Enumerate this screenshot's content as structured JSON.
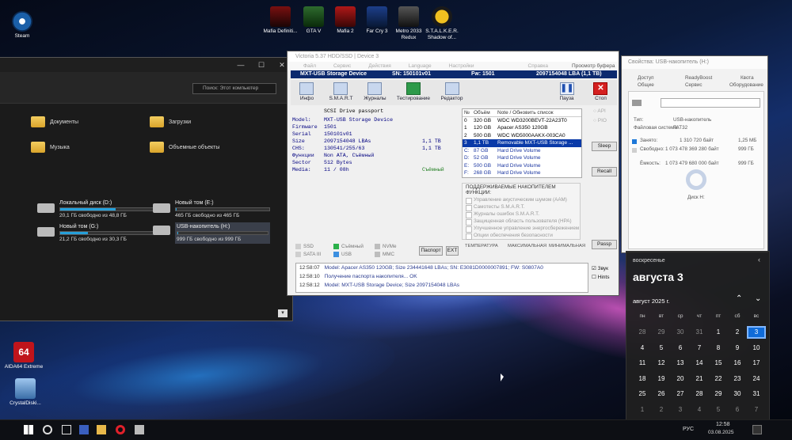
{
  "desktop": {
    "left_icons": [
      {
        "label": "Steam",
        "icon": "steam-icon"
      },
      {
        "label": "AIDA64 Extreme",
        "icon": "aida64-icon"
      },
      {
        "label": "CrystalDiski...",
        "icon": "crystaldisk-icon"
      }
    ],
    "top_icons": [
      {
        "label": "Mafia Definiti...",
        "icon": "mafia-de-icon"
      },
      {
        "label": "GTA V",
        "icon": "gta-icon"
      },
      {
        "label": "Mafia 2",
        "icon": "mafia2-icon"
      },
      {
        "label": "Far Cry 3",
        "icon": "farcry3-icon"
      },
      {
        "label": "Metro 2033 Redux",
        "icon": "metro-icon"
      },
      {
        "label": "S.T.A.L.K.E.R. Shadow of...",
        "icon": "stalker-icon"
      }
    ],
    "aida_badge": "64"
  },
  "explorer": {
    "search_placeholder": "Поиск: Этот компьютер",
    "folders": [
      "Документы",
      "Загрузки",
      "Музыка",
      "Объемные объекты"
    ],
    "drives": [
      {
        "name": "Локальный диск (D:)",
        "info": "20,1 ГБ свободно из 48,8 ГБ",
        "used_pct": 59
      },
      {
        "name": "Новый том (E:)",
        "info": "465 ГБ свободно из 465 ГБ",
        "used_pct": 1
      },
      {
        "name": "Новый том (G:)",
        "info": "21,2 ГБ свободно из 30,3 ГБ",
        "used_pct": 30
      },
      {
        "name": "USB-накопитель (H:)",
        "info": "999 ГБ свободно из 999 ГБ",
        "used_pct": 1
      }
    ]
  },
  "victoria": {
    "title": "Victoria 5.37 HDD/SSD | Device 3",
    "menu": [
      "Файл",
      "Сервис",
      "Действия",
      "Language",
      "Настройки",
      "Справка"
    ],
    "device_bar": {
      "name": "MXT-USB Storage Device",
      "sn": "SN: 150101v01",
      "fw": "Fw: 1501",
      "lba": "2097154048 LBA (1,1 TB)"
    },
    "view_buffer": "Просмотр буфера",
    "tabs": [
      "Инфо",
      "S.M.A.R.T",
      "Журналы",
      "Тестирование",
      "Редактор"
    ],
    "pause": "Пауза",
    "stop": "Стоп",
    "passport": {
      "header": "SCSI  Drive passport",
      "rows": [
        {
          "k": "Model:",
          "v": "MXT-USB Storage Device",
          "x": ""
        },
        {
          "k": "Firmware",
          "v": "1501",
          "x": ""
        },
        {
          "k": "Serial",
          "v": "150101v01",
          "x": ""
        },
        {
          "k": "Size",
          "v": "2097154048 LBAs",
          "x": "1,1 TB"
        },
        {
          "k": "CHS:",
          "v": "130541/255/63",
          "x": "1,1 TB"
        },
        {
          "k": "Функции",
          "v": "Non ATA, Съёмный",
          "x": ""
        },
        {
          "k": "Sector",
          "v": "512 Bytes",
          "x": ""
        },
        {
          "k": "Media:",
          "v": "11 / 08h",
          "x": "Съёмный"
        }
      ]
    },
    "drive_list": {
      "headers": [
        "№",
        "Объём",
        "Note / Обновить список"
      ],
      "rows": [
        {
          "n": "0",
          "size": "320 GB",
          "note": "WDC WD3200BEVT-22A23T0"
        },
        {
          "n": "1",
          "size": "120 GB",
          "note": "Apacer AS350 120GB"
        },
        {
          "n": "2",
          "size": "500 GB",
          "note": "WDC WD5000AAKX-003CA0"
        },
        {
          "n": "3",
          "size": "1,1 TB",
          "note": "Removable MXT-USB Storage ..."
        },
        {
          "n": "C:",
          "size": "87 GB",
          "note": "Hard Drive Volume"
        },
        {
          "n": "D:",
          "size": "52 GB",
          "note": "Hard Drive Volume"
        },
        {
          "n": "E:",
          "size": "500 GB",
          "note": "Hard Drive Volume"
        },
        {
          "n": "F:",
          "size": "268 GB",
          "note": "Hard Drive Volume"
        }
      ]
    },
    "side": {
      "api": "API",
      "pio": "PIO",
      "sleep": "Sleep",
      "recall": "Recall",
      "passp": "Passp"
    },
    "features": {
      "header": "ПОДДЕРЖИВАЕМЫЕ НАКОПИТЕЛЕМ ФУНКЦИИ:",
      "items": [
        "Управление акустическим шумом (AAM)",
        "Самотесты S.M.A.R.T.",
        "Журналы ошибок S.M.A.R.T.",
        "Защищенная область пользователя (HPA)",
        "Улучшенное управление энергосбережением",
        "Опции обеспечения безопасности"
      ]
    },
    "legend": [
      "SSD",
      "Съёмный",
      "NVMe",
      "SATA III",
      "USB",
      "MMC"
    ],
    "passport_btn": "Паспорт",
    "ext_btn": "EXT",
    "temp": {
      "label": "ТЕМПЕРАТУРА",
      "max": "МАКСИМАЛЬНАЯ",
      "min": "МИНИМАЛЬНАЯ"
    },
    "log": [
      {
        "time": "12:58:07",
        "text": "Model: Apacer AS350 120GB; Size 234441648 LBAs; SN: E3081D0000007891; FW: S0807A0"
      },
      {
        "time": "12:58:10",
        "text": "Получение паспорта накопителя... OK"
      },
      {
        "time": "12:58:12",
        "text": "Model: MXT-USB Storage Device; Size 2097154048 LBAs"
      }
    ],
    "sound": "Звук",
    "hints": "Hints"
  },
  "props": {
    "title": "Свойства: USB-накопитель (H:)",
    "tabs": [
      "Доступ",
      "ReadyBoost",
      "Квота",
      "Общие",
      "Сервис",
      "Оборудование"
    ],
    "type_label": "Тип:",
    "type_value": "USB-накопитель",
    "fs_label": "Файловая система:",
    "fs_value": "FAT32",
    "used_label": "Занято:",
    "used_bytes": "1 310 720 байт",
    "used_size": "1,25 МБ",
    "free_label": "Свободно:",
    "free_bytes": "1 073 478 369 280 байт",
    "free_size": "999 ГБ",
    "cap_label": "Ёмкость:",
    "cap_bytes": "1 073 479 680 000 байт",
    "cap_size": "999 ГБ",
    "disk_label": "Диск H:"
  },
  "calendar": {
    "weekday": "воскресенье",
    "date": "августа 3",
    "month": "август 2025 г.",
    "dow": [
      "пн",
      "вт",
      "ср",
      "чт",
      "пт",
      "сб",
      "вс"
    ],
    "weeks": [
      [
        "28",
        "29",
        "30",
        "31",
        "1",
        "2",
        "3"
      ],
      [
        "4",
        "5",
        "6",
        "7",
        "8",
        "9",
        "10"
      ],
      [
        "11",
        "12",
        "13",
        "14",
        "15",
        "16",
        "17"
      ],
      [
        "18",
        "19",
        "20",
        "21",
        "22",
        "23",
        "24"
      ],
      [
        "25",
        "26",
        "27",
        "28",
        "29",
        "30",
        "31"
      ],
      [
        "1",
        "2",
        "3",
        "4",
        "5",
        "6",
        "7"
      ]
    ],
    "today": "3"
  },
  "taskbar": {
    "lang": "РУС",
    "time": "12:58",
    "date": "03.08.2025"
  },
  "colors": {
    "accent": "#0f6bd8",
    "victoria_bar": "#0c2a6e",
    "selected_row": "#0a3aa8"
  }
}
